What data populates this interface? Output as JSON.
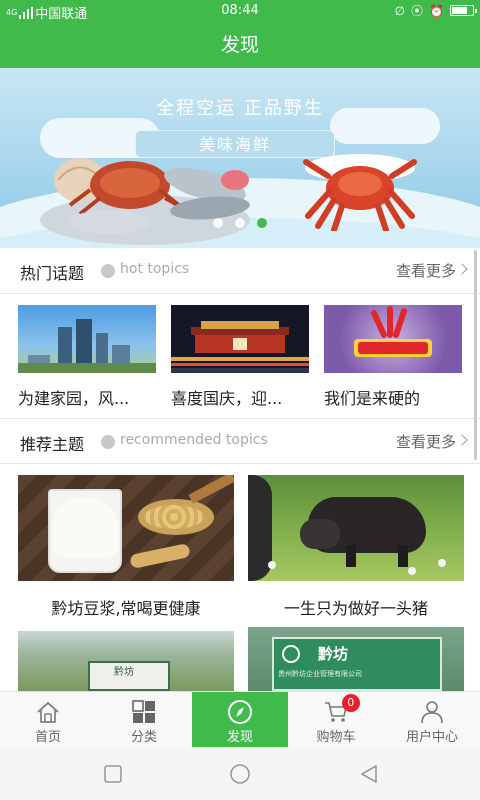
{
  "status_bar": {
    "carrier": "中国联通",
    "time": "08:44",
    "net": "4G"
  },
  "header": {
    "title": "发现"
  },
  "banner": {
    "slogan": "全程空运   正品野生",
    "tag": "美味海鲜",
    "slides": 3,
    "active_slide": 3
  },
  "hot_topics": {
    "title": "热门话题",
    "subtitle": "hot topics",
    "more": "查看更多",
    "items": [
      {
        "caption": "为建家园，风...",
        "image": "city-skyline-photo"
      },
      {
        "caption": "喜度国庆，迎...",
        "image": "tiananmen-night-photo"
      },
      {
        "caption": "我们是来硬的",
        "image": "china-good-product-logo"
      }
    ]
  },
  "recommended": {
    "title": "推荐主题",
    "subtitle": "recommended topics",
    "more": "查看更多",
    "items": [
      {
        "caption": "黔坊豆浆,常喝更健康",
        "image": "soy-milk-photo"
      },
      {
        "caption": "一生只为做好一头猪",
        "image": "black-pig-photo"
      },
      {
        "caption": "",
        "image": "farm-field-sign-photo",
        "sign": "黔坊"
      },
      {
        "caption": "",
        "image": "company-sign-photo",
        "sign": "黔坊",
        "sign_sub": "贵州黔坊企业管理有限公司"
      }
    ]
  },
  "tab_bar": {
    "tabs": [
      {
        "label": "首页",
        "icon": "home-icon"
      },
      {
        "label": "分类",
        "icon": "grid-icon"
      },
      {
        "label": "发现",
        "icon": "compass-icon",
        "active": true
      },
      {
        "label": "购物车",
        "icon": "cart-icon",
        "badge": "0"
      },
      {
        "label": "用户中心",
        "icon": "user-icon"
      }
    ]
  },
  "colors": {
    "brand": "#3fba4b",
    "badge": "#e8202a"
  }
}
